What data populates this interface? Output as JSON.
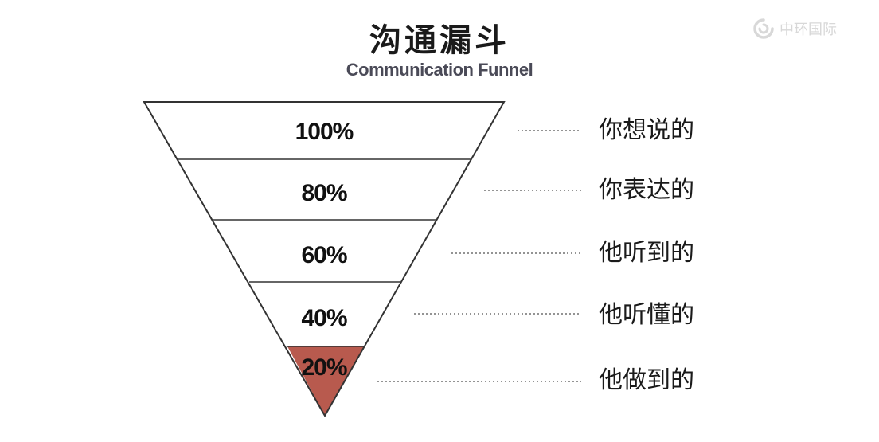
{
  "title": "沟通漏斗",
  "subtitle": "Communication Funnel",
  "logo": {
    "text": "中环国际",
    "icon": "swirl-logo-icon",
    "color": "#d8d8d8"
  },
  "funnel": {
    "levels": [
      {
        "percent": "100%",
        "label": "你想说的"
      },
      {
        "percent": "80%",
        "label": "你表达的"
      },
      {
        "percent": "60%",
        "label": "他听到的"
      },
      {
        "percent": "40%",
        "label": "他听懂的"
      },
      {
        "percent": "20%",
        "label": "他做到的",
        "highlight": true
      }
    ],
    "highlight_color": "#b85a4e",
    "line_color": "#333333",
    "leader_style": "dotted"
  }
}
